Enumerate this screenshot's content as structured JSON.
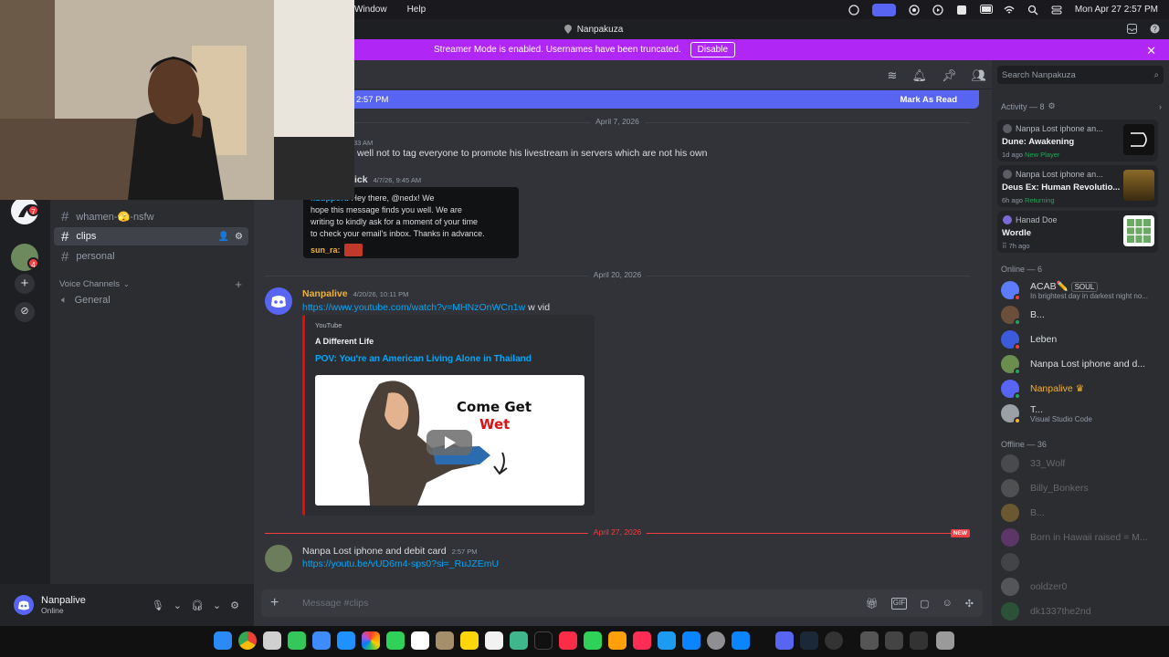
{
  "menubar": {
    "menus": [
      "Window",
      "Help"
    ],
    "clock": "Mon Apr 27  2:57 PM"
  },
  "window": {
    "title": "Nanpakuza"
  },
  "banner": {
    "text": "Streamer Mode is enabled. Usernames have been truncated.",
    "button": "Disable"
  },
  "rail": {
    "badges": [
      "7",
      "4"
    ]
  },
  "sidebar": {
    "channels": [
      {
        "name": "whamen-🫣-nsfw"
      },
      {
        "name": "clips"
      },
      {
        "name": "personal"
      }
    ],
    "voice_header": "Voice Channels",
    "voice_channels": [
      "General"
    ]
  },
  "user": {
    "name": "Nanpalive",
    "status": "Online"
  },
  "chat": {
    "new_bar": {
      "since": "2:57 PM",
      "action": "Mark As Read"
    },
    "date1": "April 7, 2026",
    "date2": "April 20, 2026",
    "date3": "April 27, 2026",
    "new_tag": "NEW",
    "msg1": {
      "time": "33 AM",
      "text": "well not to tag everyone to promote his livestream in servers which are not his own"
    },
    "msg2": {
      "author": "ick",
      "time": "4/7/26, 9:45 AM"
    },
    "screenshot": {
      "sender": "kSupport",
      "lines": [
        "Hey there, @nedx! We",
        "hope this message finds you well. We are",
        "writing to kindly ask for a moment of your time",
        "to check your email's inbox. Thanks in advance."
      ],
      "reply_author": "sun_ra:"
    },
    "msg3": {
      "author": "Nanpalive",
      "time": "4/20/26, 10:11 PM",
      "link": "https://www.youtube.com/watch?v=MHNzOnWCn1w",
      "suffix": "w vid"
    },
    "embed": {
      "provider": "YouTube",
      "author": "A Different Life",
      "title": "POV: You're an American Living Alone in Thailand",
      "thumb_line1": "Come Get",
      "thumb_line2": "Wet"
    },
    "msg4": {
      "author": "Nanpa Lost iphone and debit card",
      "time": "2:57 PM",
      "link": "https://youtu.be/vUD6m4-sps0?si=_RuJZEmU"
    },
    "composer_placeholder": "Message #clips"
  },
  "members": {
    "search_placeholder": "Search Nanpakuza",
    "activity_header": "Activity — 8",
    "activities": [
      {
        "user": "Nanpa Lost iphone an...",
        "game": "Dune: Awakening",
        "ago": "1d ago",
        "tag": "New Player",
        "art": "#111111"
      },
      {
        "user": "Nanpa Lost iphone an...",
        "game": "Deus Ex: Human Revolutio...",
        "ago": "6h ago",
        "tag": "Returning",
        "art": "#7a5a1e"
      },
      {
        "user": "Hanad Doe",
        "game": "Wordle",
        "ago": "7h ago",
        "tag": "",
        "art": "#6aaa64"
      }
    ],
    "online_header": "Online — 6",
    "online": [
      {
        "name": "ACAB✏️",
        "badge": "SOUL",
        "status": "In brightest day in darkest night no...",
        "color": "#5c7cfa",
        "dot": "#f23f43"
      },
      {
        "name": "B...",
        "status": "",
        "color": "#6b4f3a",
        "dot": "#23a55a"
      },
      {
        "name": "Leben",
        "status": "",
        "color": "#3b5bdb",
        "dot": "#f23f43"
      },
      {
        "name": "Nanpa Lost iphone and d...",
        "status": "",
        "color": "#6b8e4e",
        "dot": "#23a55a"
      },
      {
        "name": "Nanpalive",
        "status": "",
        "color": "#5865f2",
        "dot": "#23a55a",
        "owner": true
      },
      {
        "name": "T...",
        "status": "Visual Studio Code",
        "color": "#9aa0a6",
        "dot": "#f0b232"
      }
    ],
    "offline_header": "Offline — 36",
    "offline": [
      "33_Wolf",
      "Billy_Bonkers",
      "B...",
      "Born in Hawaii raised = M...",
      "",
      "ooldzer0",
      "dk1337the2nd"
    ]
  },
  "colors": {
    "blurple": "#5865f2",
    "streamer": "#b026f5",
    "danger": "#f23f43"
  }
}
